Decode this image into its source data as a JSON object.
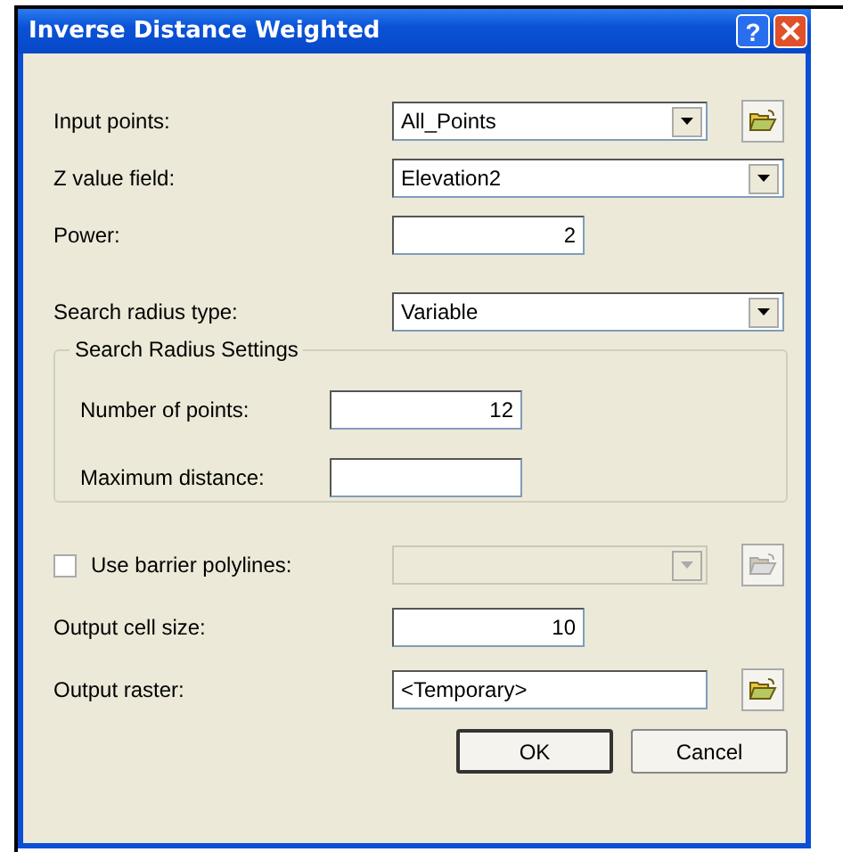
{
  "window": {
    "title": "Inverse Distance Weighted",
    "help": "?"
  },
  "fields": [
    {
      "kind": "combo",
      "label": "Input points:",
      "value": "All_Points",
      "browse": true
    },
    {
      "kind": "combo",
      "label": "Z value field:",
      "value": "Elevation2",
      "browse": false
    },
    {
      "kind": "text",
      "label": "Power:",
      "value": "2",
      "browse": false
    },
    {
      "kind": "combo",
      "label": "Search radius type:",
      "value": "Variable",
      "browse": false
    }
  ],
  "group": {
    "title": "Search Radius Settings",
    "fields": [
      {
        "kind": "text",
        "label": "Number of points:",
        "value": "12"
      },
      {
        "kind": "text",
        "label": "Maximum distance:"
      }
    ]
  },
  "fields_after": [
    {
      "kind": "check-combo",
      "label": "Use barrier polylines:",
      "checked": false,
      "disabled": true,
      "browse": true
    },
    {
      "kind": "text",
      "label": "Output cell size:",
      "value": "10",
      "browse": false
    },
    {
      "kind": "text",
      "label": "Output raster:",
      "value": "<Temporary>",
      "browse": true
    }
  ],
  "buttons": [
    {
      "label": "OK",
      "default": true
    },
    {
      "label": "Cancel",
      "default": false
    }
  ]
}
